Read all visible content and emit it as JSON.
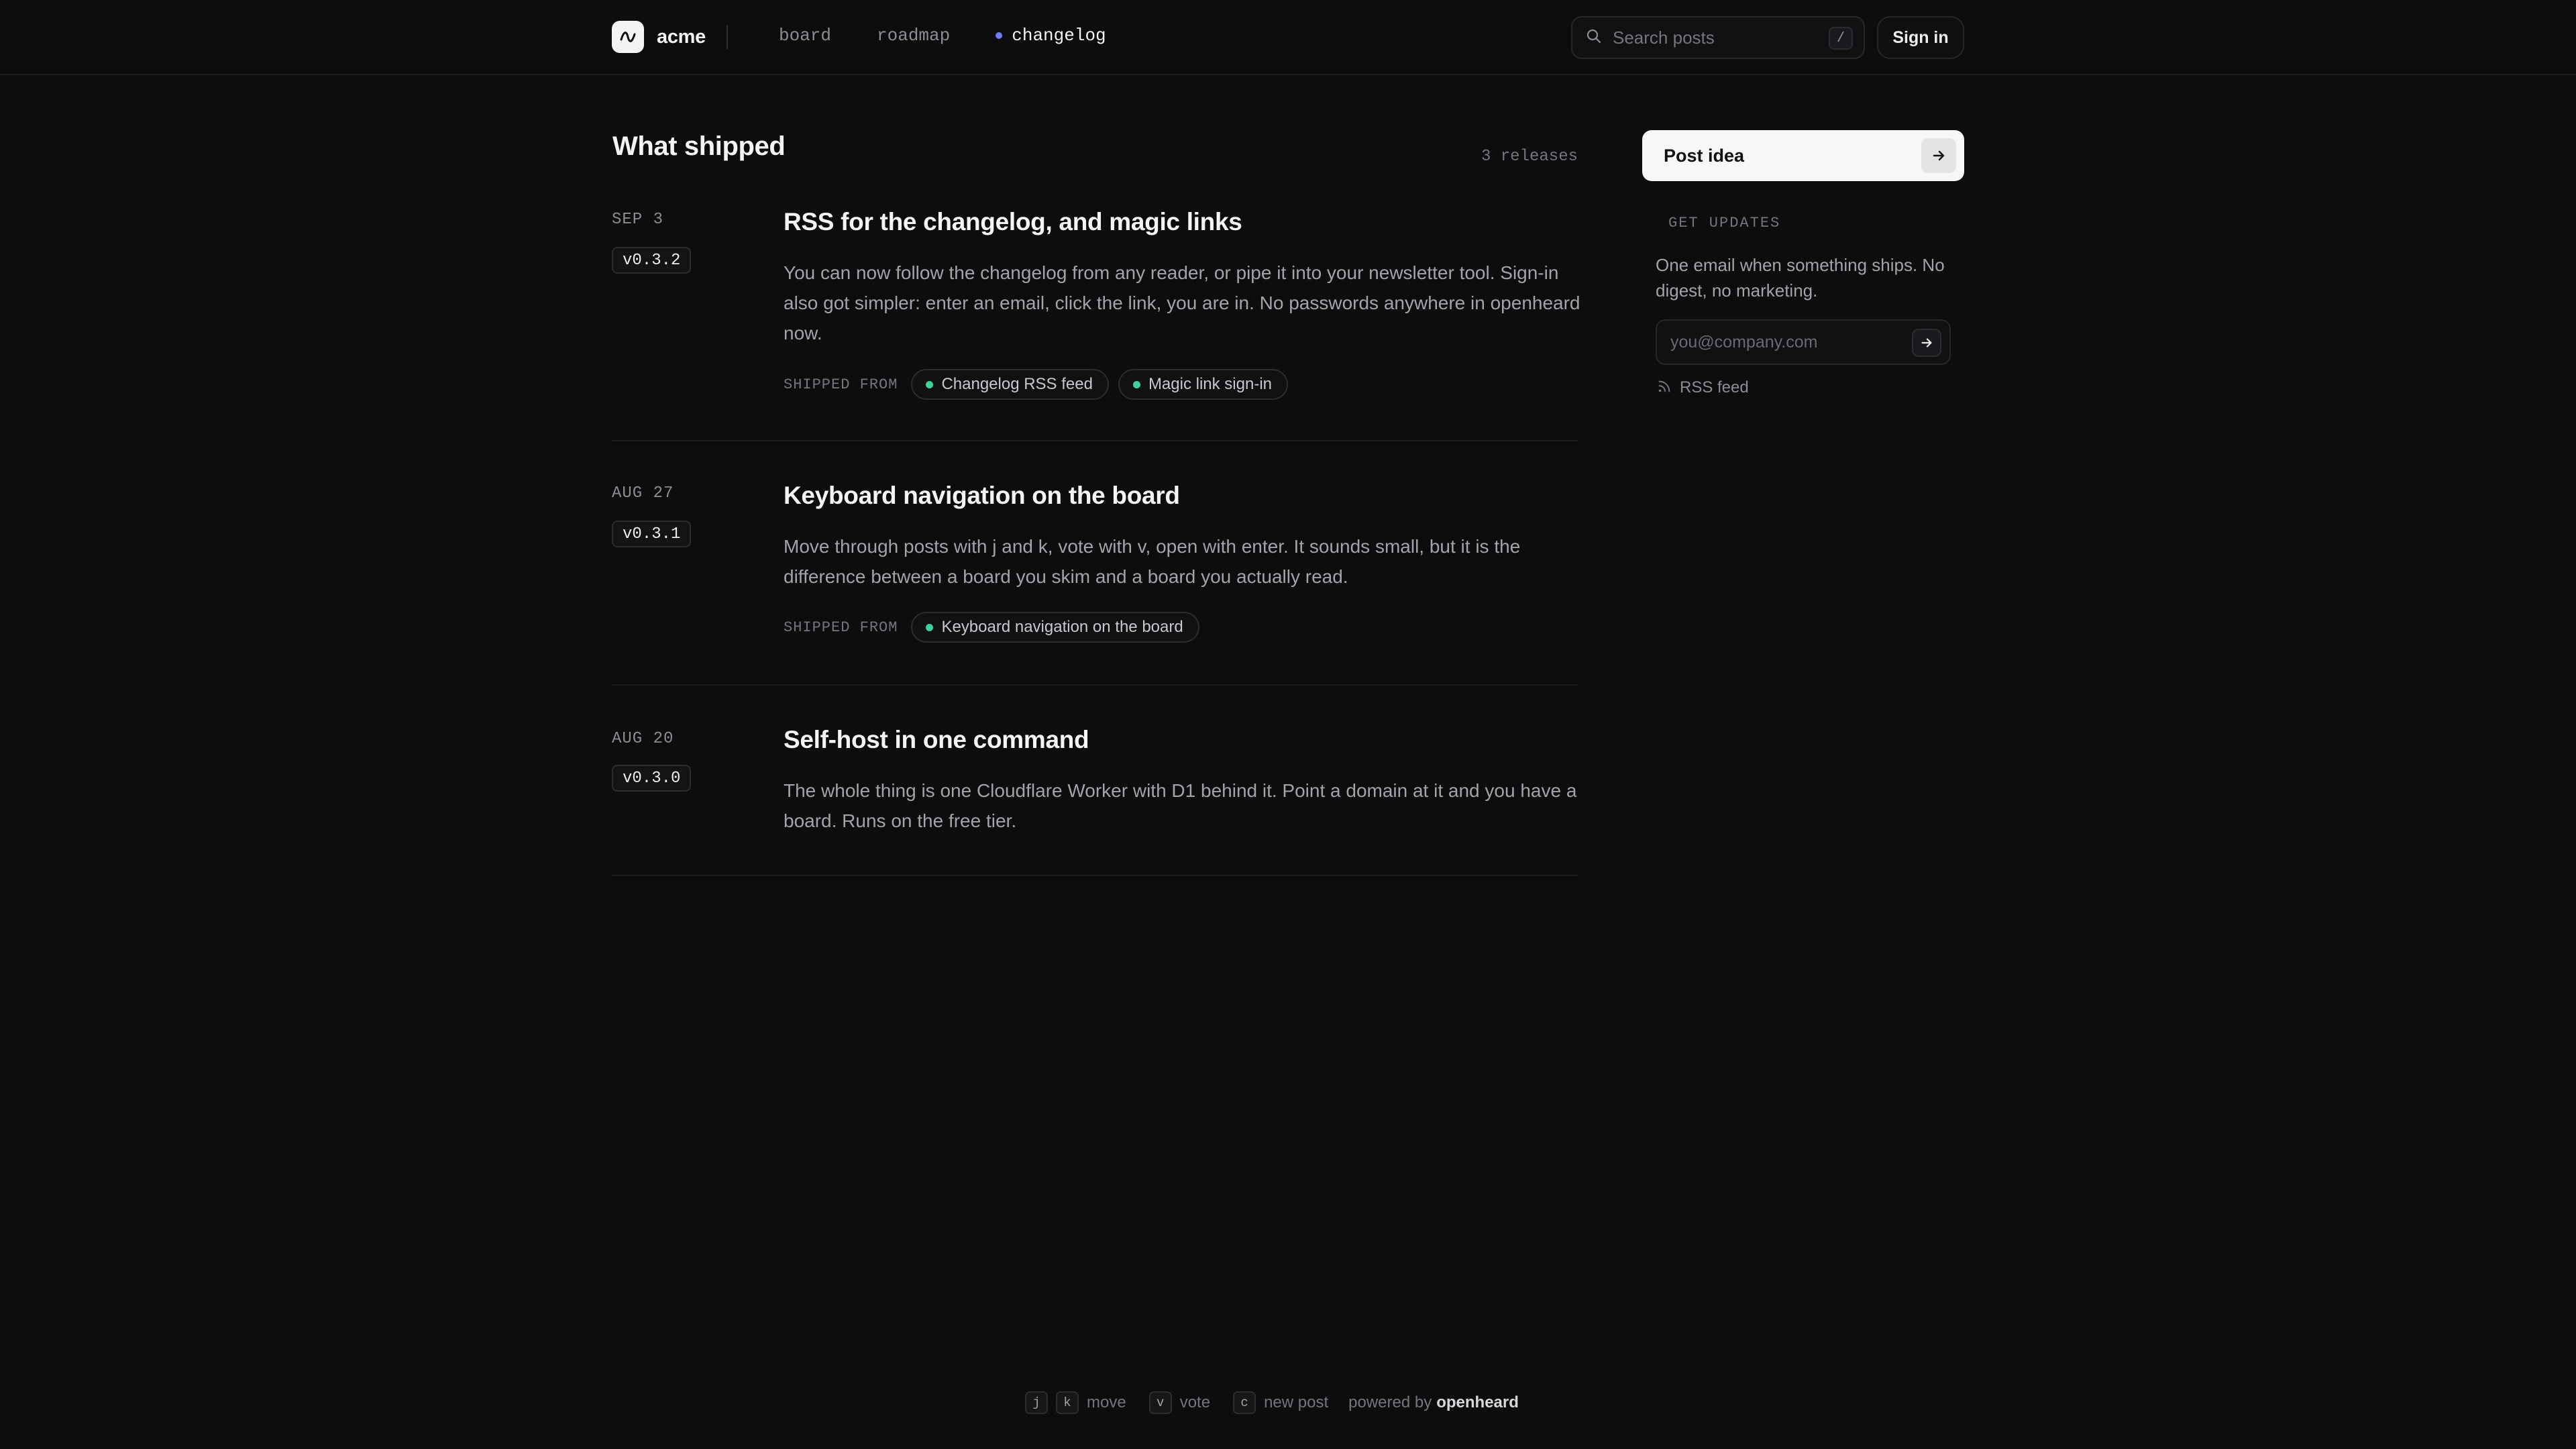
{
  "header": {
    "brand": "acme",
    "nav": {
      "board": "board",
      "roadmap": "roadmap",
      "changelog": "changelog"
    },
    "search_placeholder": "Search posts",
    "search_shortcut": "/",
    "sign_in": "Sign in"
  },
  "main": {
    "title": "What shipped",
    "release_count": "3 releases",
    "releases": [
      {
        "date": "SEP 3",
        "version": "v0.3.2",
        "title": "RSS for the changelog, and magic links",
        "body": "You can now follow the changelog from any reader, or pipe it into your newsletter tool. Sign-in also got simpler: enter an email, click the link, you are in. No passwords anywhere in openheard now.",
        "shipped_from_label": "SHIPPED FROM",
        "shipped_from": [
          "Changelog RSS feed",
          "Magic link sign-in"
        ]
      },
      {
        "date": "AUG 27",
        "version": "v0.3.1",
        "title": "Keyboard navigation on the board",
        "body": "Move through posts with j and k, vote with v, open with enter. It sounds small, but it is the difference between a board you skim and a board you actually read.",
        "shipped_from_label": "SHIPPED FROM",
        "shipped_from": [
          "Keyboard navigation on the board"
        ]
      },
      {
        "date": "AUG 20",
        "version": "v0.3.0",
        "title": "Self-host in one command",
        "body": "The whole thing is one Cloudflare Worker with D1 behind it. Point a domain at it and you have a board. Runs on the free tier."
      }
    ]
  },
  "sidebar": {
    "post_idea": "Post idea",
    "updates_label": "GET UPDATES",
    "updates_desc": "One email when something ships. No digest, no marketing.",
    "email_placeholder": "you@company.com",
    "rss": "RSS feed"
  },
  "footer": {
    "keys": {
      "j": "j",
      "k": "k",
      "move": "move",
      "v": "v",
      "vote": "vote",
      "c": "c",
      "new_post": "new post"
    },
    "powered_by": "powered by",
    "powered_brand": "openheard"
  },
  "colors": {
    "background": "#0d0d0f",
    "accent": "#6d7ff2",
    "shipped_dot": "#3ed29a"
  },
  "icons": [
    "wave-logo-icon",
    "search-icon",
    "arrow-right-icon",
    "rss-icon"
  ]
}
